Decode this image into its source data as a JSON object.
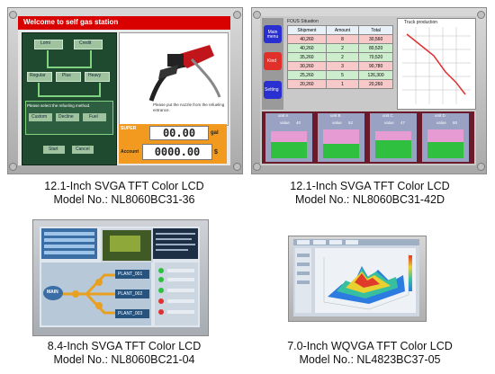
{
  "products": [
    {
      "caption_line1": "12.1-Inch SVGA TFT Color LCD",
      "caption_line2": "Model No.: NL8060BC31-36",
      "screen": {
        "banner": "Welcome to self gas station",
        "flow_boxes": [
          "Lomi",
          "Credit",
          "Regular",
          "Plus",
          "Heavy"
        ],
        "instruction": "Please select the refueling method.",
        "method_buttons": [
          "Custom",
          "Decline",
          "Fuel"
        ],
        "bottom_buttons": [
          "Start",
          "Cancel"
        ],
        "message": "Please put the nozzle from the refueling entrance.",
        "grade": "SUPER",
        "volume": "00.00",
        "volume_unit": "gal",
        "account_label": "Account",
        "account": "0000.00",
        "account_unit": "$"
      }
    },
    {
      "caption_line1": "12.1-Inch SVGA TFT Color LCD",
      "caption_line2": "Model No.: NL8060BC31-42D",
      "screen": {
        "side_buttons": [
          "Main menu",
          "Kind",
          "Setting"
        ],
        "table_title": "FOUS Situation",
        "chart_title": "Truck production",
        "columns": [
          "Shipment",
          "Amount",
          "Total"
        ],
        "rows": [
          [
            "40,260",
            "8",
            "30,560"
          ],
          [
            "40,260",
            "2",
            "80,520"
          ],
          [
            "35,260",
            "2",
            "70,520"
          ],
          [
            "30,260",
            "3",
            "90,780"
          ],
          [
            "25,260",
            "5",
            "126,300"
          ],
          [
            "20,260",
            "1",
            "20,260"
          ]
        ],
        "unit_labels": [
          "unit A",
          "unit B",
          "unit C",
          "unit D"
        ],
        "value_labels": [
          "value",
          "value",
          "value",
          "value"
        ],
        "values": [
          "40",
          "52",
          "47",
          "60"
        ]
      }
    },
    {
      "caption_line1": "8.4-Inch SVGA TFT Color LCD",
      "caption_line2": "Model No.: NL8060BC21-04",
      "screen": {
        "main_node": "MAIN",
        "plants": [
          "PLANT_001",
          "PLANT_002",
          "PLANT_003"
        ]
      }
    },
    {
      "caption_line1": "7.0-Inch WQVGA TFT Color LCD",
      "caption_line2": "Model No.: NL4823BC37-05"
    }
  ]
}
